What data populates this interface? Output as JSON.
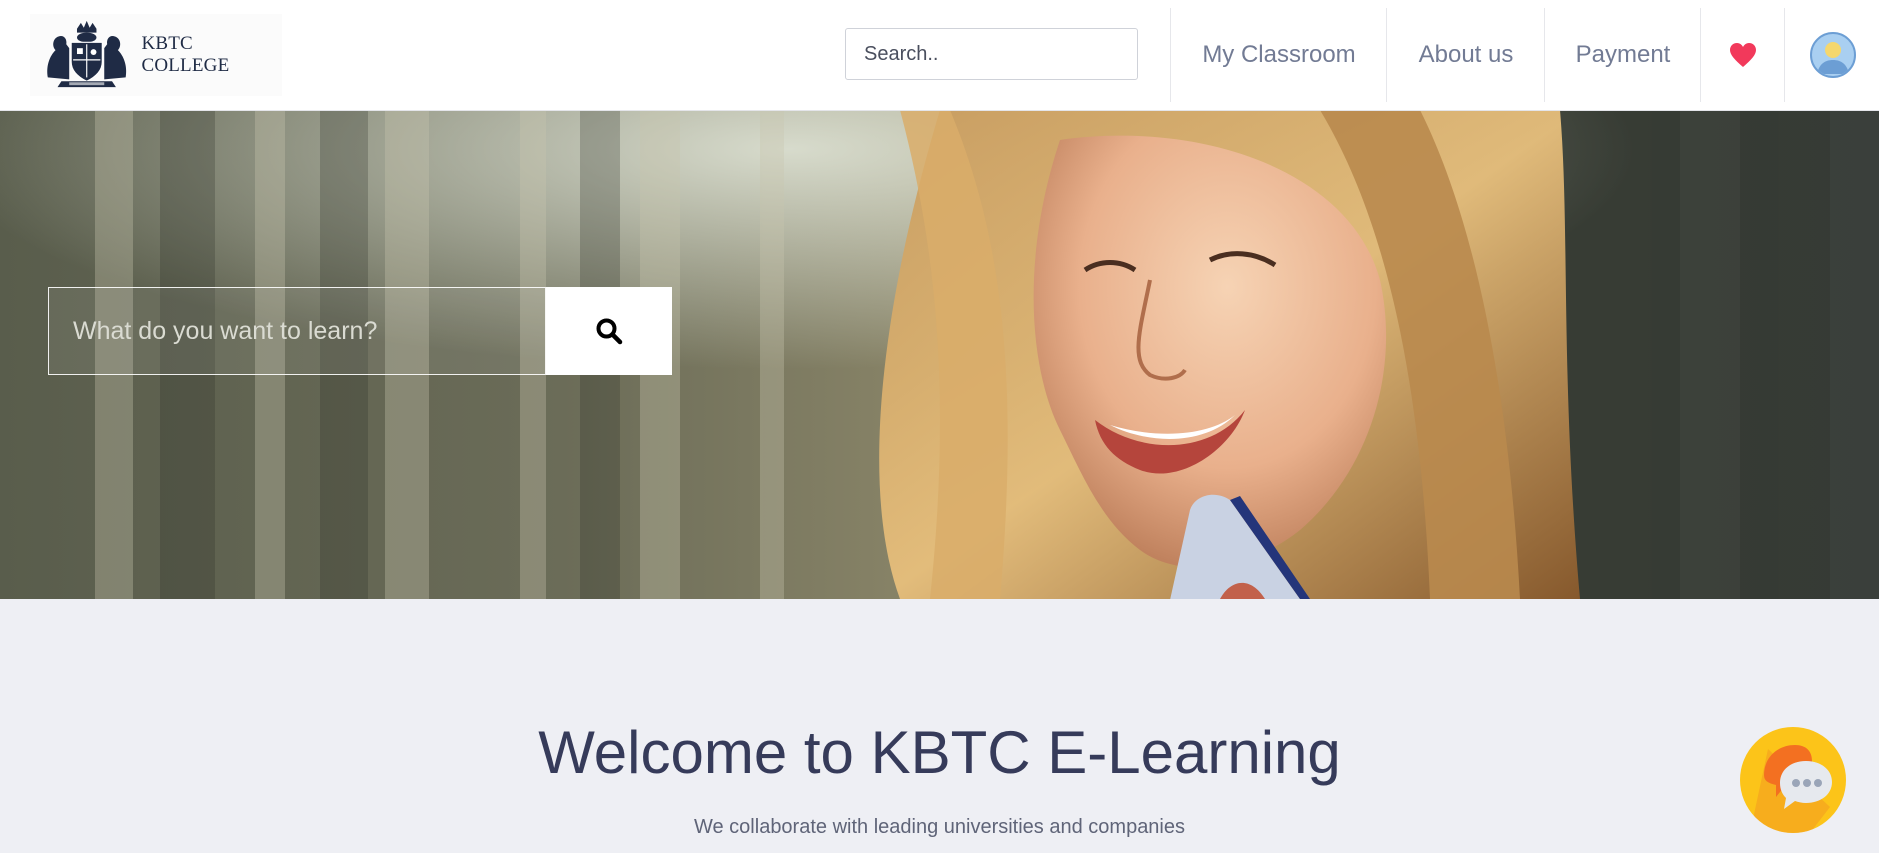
{
  "navbar": {
    "logo_text": "KBTC COLLEGE",
    "search_placeholder": "Search..",
    "links": {
      "classroom": "My Classroom",
      "about": "About us",
      "payment": "Payment"
    },
    "heart_color": "#f2395b"
  },
  "hero": {
    "search_placeholder": "What do you want to learn?"
  },
  "welcome": {
    "title": "Welcome to KBTC E-Learning",
    "subtitle": "We collaborate with leading universities and companies"
  },
  "colors": {
    "nav_text": "#727b94",
    "title": "#363b5a",
    "chat_yellow": "#fcc419",
    "chat_orange": "#f37021"
  }
}
